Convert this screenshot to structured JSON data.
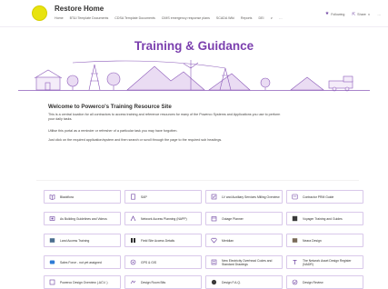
{
  "header": {
    "site_title": "Restore Home",
    "nav": [
      "Home",
      "BT&I Template Documents",
      "CDSA Template Documents",
      "CIMS emergency response plans",
      "SCADA Wiki",
      "Reports",
      "DEI",
      "∨",
      "…"
    ],
    "following_label": "Following",
    "share_label": "Share",
    "share_chevron": "∨",
    "more_label": "…"
  },
  "page_title": "Training & Guidance",
  "intro": {
    "heading": "Welcome to Powerco's Training Resource Site",
    "para1": "This is a central location for all contractors to access training and reference resources for many of the Powerco Systems and Applications you use to perform your daily tasks.",
    "para2": "Utilise this portal as a reminder or refresher of a particular task you may have forgotten.",
    "para3": "Just click on the required application/system and then search or scroll through the page to the required sub headings."
  },
  "tiles": [
    {
      "label": "Blackflora",
      "icon": "book-icon"
    },
    {
      "label": "SAP",
      "icon": "document-icon"
    },
    {
      "label": "LV and Auxiliary Services Milling Overview",
      "icon": "checklist-icon"
    },
    {
      "label": "Contractor PRM Guide",
      "icon": "guide-icon"
    },
    {
      "label": "As Building Guidelines and Videos",
      "icon": "building-icon"
    },
    {
      "label": "Network Access Planning (NAPP)",
      "icon": "network-icon"
    },
    {
      "label": "Outage Planner",
      "icon": "planner-icon"
    },
    {
      "label": "Voyager Training and Guides",
      "icon": "voyager-icon"
    },
    {
      "label": "Land Access Training",
      "icon": "landscape-icon"
    },
    {
      "label": "Field Site Access Details",
      "icon": "field-icon"
    },
    {
      "label": "Meridian",
      "icon": "heart-icon"
    },
    {
      "label": "Neara Design",
      "icon": "neara-icon"
    },
    {
      "label": "Sales Force - not yet assigned",
      "icon": "cloud-icon"
    },
    {
      "label": "GPS & GIS",
      "icon": "gps-icon"
    },
    {
      "label": "New Electricity Overhead Codes and Standard Drawings",
      "icon": "codes-icon"
    },
    {
      "label": "The Network Asset Design Register (NADR)",
      "icon": "register-icon"
    },
    {
      "label": "Powerco Design Overview (.ACV..)",
      "icon": "design-overview-icon"
    },
    {
      "label": "Design Room Bits",
      "icon": "design-room-icon"
    },
    {
      "label": "Design F.A.Q.",
      "icon": "faq-icon"
    },
    {
      "label": "Design Review",
      "icon": "review-icon"
    }
  ],
  "colors": {
    "accent": "#7b3fae",
    "tile_border": "#d9c8ea",
    "logo": "#e8e30e"
  }
}
